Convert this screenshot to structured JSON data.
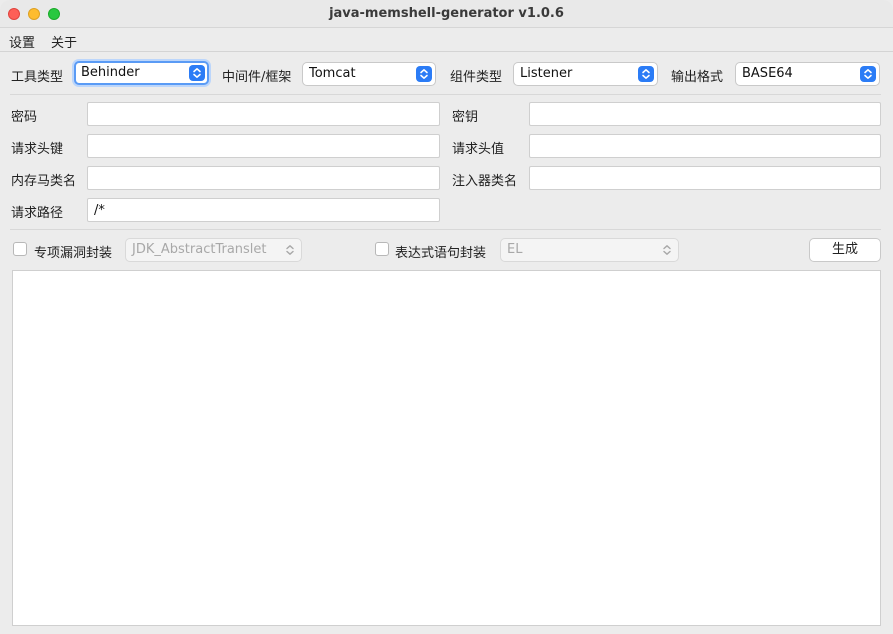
{
  "window": {
    "title": "java-memshell-generator v1.0.6"
  },
  "menu": {
    "settings": "设置",
    "about": "关于"
  },
  "row1": {
    "tool_type_label": "工具类型",
    "tool_type_value": "Behinder",
    "middleware_label": "中间件/框架",
    "middleware_value": "Tomcat",
    "component_label": "组件类型",
    "component_value": "Listener",
    "output_label": "输出格式",
    "output_value": "BASE64"
  },
  "fields": {
    "password_label": "密码",
    "password_value": "",
    "key_label": "密钥",
    "key_value": "",
    "header_key_label": "请求头键",
    "header_key_value": "",
    "header_value_label": "请求头值",
    "header_value_value": "",
    "shell_class_label": "内存马类名",
    "shell_class_value": "",
    "injector_class_label": "注入器类名",
    "injector_class_value": "",
    "request_path_label": "请求路径",
    "request_path_value": "/*"
  },
  "options": {
    "gadget_label": "专项漏洞封装",
    "gadget_checked": false,
    "gadget_value": "JDK_AbstractTranslet",
    "expr_label": "表达式语句封装",
    "expr_checked": false,
    "expr_value": "EL",
    "generate_label": "生成"
  },
  "output": {
    "text": ""
  },
  "colors": {
    "accent": "#2b7cf6",
    "focus_ring": "#5a9bf5",
    "close": "#fe5f57",
    "minimize": "#febc2e",
    "maximize": "#28c840"
  }
}
